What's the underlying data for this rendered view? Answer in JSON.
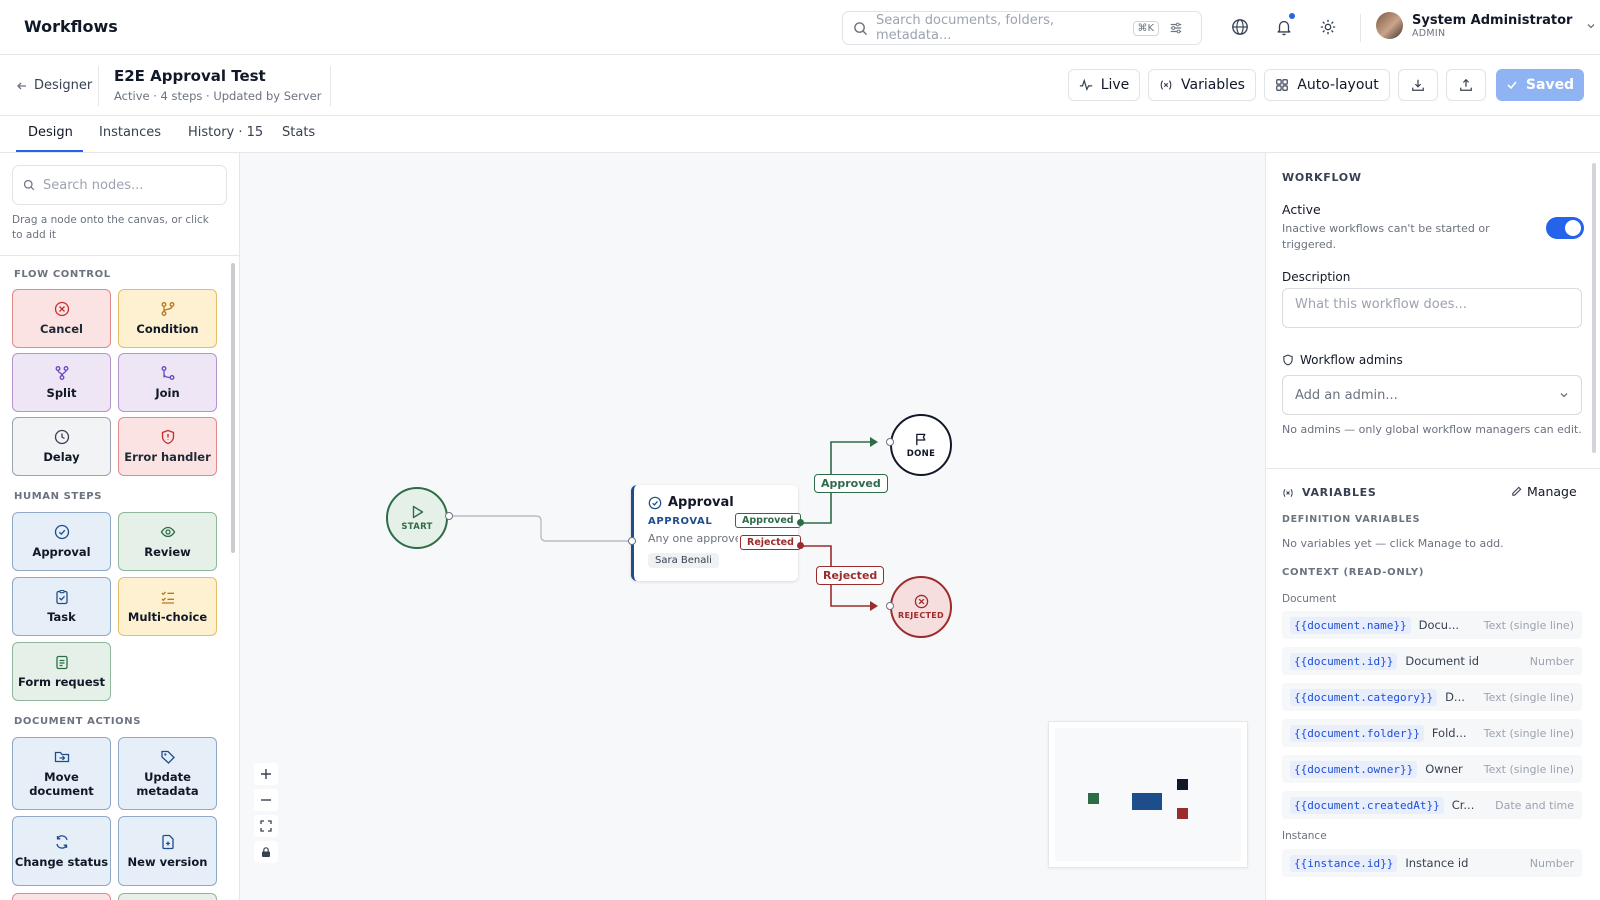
{
  "topbar": {
    "title": "Workflows",
    "search_placeholder": "Search documents, folders, metadata...",
    "search_shortcut": "⌘K",
    "user_name": "System Administrator",
    "user_role": "ADMIN"
  },
  "subbar": {
    "back_label": "Designer",
    "workflow_title": "E2E Approval Test",
    "workflow_meta": "Active · 4 steps · Updated by Server",
    "live_label": "Live",
    "variables_label": "Variables",
    "autolayout_label": "Auto-layout",
    "saved_label": "Saved"
  },
  "tabs": [
    "Design",
    "Instances",
    "History · 15",
    "Stats"
  ],
  "palette": {
    "search_placeholder": "Search nodes...",
    "hint": "Drag a node onto the canvas, or click to add it",
    "sections": [
      "FLOW CONTROL",
      "HUMAN STEPS",
      "DOCUMENT ACTIONS"
    ],
    "flow_control": [
      "Cancel",
      "Condition",
      "Split",
      "Join",
      "Delay",
      "Error handler"
    ],
    "human_steps": [
      "Approval",
      "Review",
      "Task",
      "Multi-choice",
      "Form request"
    ],
    "document_actions": [
      "Move document",
      "Update metadata",
      "Change status",
      "New version"
    ]
  },
  "canvas": {
    "start_label": "START",
    "done_label": "DONE",
    "rejected_label": "REJECTED",
    "approval": {
      "title": "Approval",
      "type": "APPROVAL",
      "desc": "Any one approves",
      "assignee": "Sara Benali",
      "out_approved": "Approved",
      "out_rejected": "Rejected"
    },
    "edge_approved": "Approved",
    "edge_rejected": "Rejected",
    "colors": {
      "green": "#2e6b47",
      "red": "#9b2c2c",
      "blue": "#1e4d8c",
      "dark": "#111827"
    }
  },
  "props": {
    "workflow_section": "WORKFLOW",
    "active_label": "Active",
    "active_help": "Inactive workflows can't be started or triggered.",
    "active": true,
    "description_label": "Description",
    "description_placeholder": "What this workflow does...",
    "admins_label": "Workflow admins",
    "admins_placeholder": "Add an admin...",
    "admins_help": "No admins — only global workflow managers can edit.",
    "variables_section": "VARIABLES",
    "manage_label": "Manage",
    "definition_vars_label": "DEFINITION VARIABLES",
    "definition_vars_empty": "No variables yet — click Manage to add.",
    "context_label": "CONTEXT (READ-ONLY)",
    "document_group": "Document",
    "instance_group": "Instance",
    "document_vars": [
      {
        "key": "{{document.name}}",
        "desc": "Docu...",
        "type": "Text (single line)"
      },
      {
        "key": "{{document.id}}",
        "desc": "Document id",
        "type": "Number"
      },
      {
        "key": "{{document.category}}",
        "desc": "D...",
        "type": "Text (single line)"
      },
      {
        "key": "{{document.folder}}",
        "desc": "Fold...",
        "type": "Text (single line)"
      },
      {
        "key": "{{document.owner}}",
        "desc": "Owner",
        "type": "Text (single line)"
      },
      {
        "key": "{{document.createdAt}}",
        "desc": "Cr...",
        "type": "Date and time"
      }
    ],
    "instance_vars": [
      {
        "key": "{{instance.id}}",
        "desc": "Instance id",
        "type": "Number"
      }
    ]
  }
}
